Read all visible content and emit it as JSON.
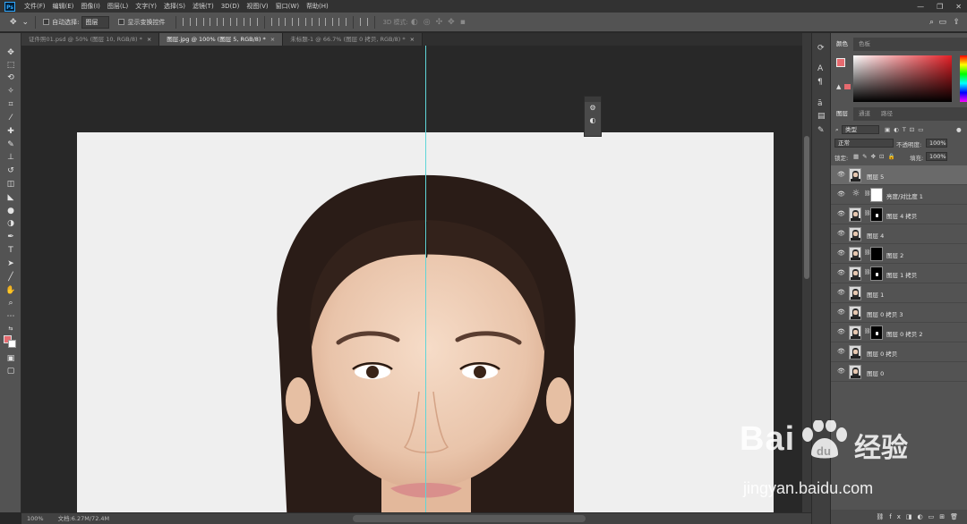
{
  "app": {
    "logo_text": "Ps",
    "menus": [
      "文件(F)",
      "编辑(E)",
      "图像(I)",
      "图层(L)",
      "文字(Y)",
      "选择(S)",
      "滤镜(T)",
      "3D(D)",
      "视图(V)",
      "窗口(W)",
      "帮助(H)"
    ]
  },
  "options_bar": {
    "auto_select_label": "自动选择:",
    "auto_select_value": "图层",
    "show_transform_label": "显示变换控件",
    "mode_3d_label": "3D 模式:"
  },
  "tabs": [
    {
      "label": "证件照01.psd @ 50% (图层 10, RGB/8) *",
      "active": false
    },
    {
      "label": "图层.jpg @ 100% (图层 5, RGB/8) *",
      "active": true
    },
    {
      "label": "未标题-1 @ 66.7% (图层 0 拷贝, RGB/8) *",
      "active": false
    }
  ],
  "status": {
    "zoom": "100%",
    "doc_size": "文档:6.27M/72.4M"
  },
  "color_panel": {
    "tabs": [
      "颜色",
      "色板"
    ],
    "fg_color": "#e66a6f",
    "bg_color": "#ffffff"
  },
  "layers_panel": {
    "tabs": [
      "图层",
      "通道",
      "路径"
    ],
    "filter_label": "类型",
    "blend_mode": "正常",
    "opacity_label": "不透明度:",
    "opacity_value": "100%",
    "lock_label": "锁定:",
    "fill_label": "填充:",
    "fill_value": "100%",
    "layers": [
      {
        "name": "图层 5",
        "selected": true,
        "type": "photo"
      },
      {
        "name": "亮度/对比度 1",
        "selected": false,
        "type": "adjustment"
      },
      {
        "name": "图层 4 拷贝",
        "selected": false,
        "type": "photo-mask-portrait"
      },
      {
        "name": "图层 4",
        "selected": false,
        "type": "photo"
      },
      {
        "name": "图层 2",
        "selected": false,
        "type": "photo-mask-black"
      },
      {
        "name": "图层 1 拷贝",
        "selected": false,
        "type": "photo-mask-spot"
      },
      {
        "name": "图层 1",
        "selected": false,
        "type": "photo"
      },
      {
        "name": "图层 0 拷贝 3",
        "selected": false,
        "type": "photo"
      },
      {
        "name": "图层 0 拷贝 2",
        "selected": false,
        "type": "photo-mask-spot"
      },
      {
        "name": "图层 0 拷贝",
        "selected": false,
        "type": "photo"
      },
      {
        "name": "图层 0",
        "selected": false,
        "type": "photo"
      }
    ]
  },
  "watermark": {
    "logo": "Bai",
    "logo_suffix": "du",
    "brand": "经验",
    "url": "jingyan.baidu.com"
  },
  "icons": {
    "move": "move-icon",
    "search": "search-icon",
    "workspace": "workspace-icon",
    "share": "share-icon",
    "eye": "eye-icon"
  }
}
